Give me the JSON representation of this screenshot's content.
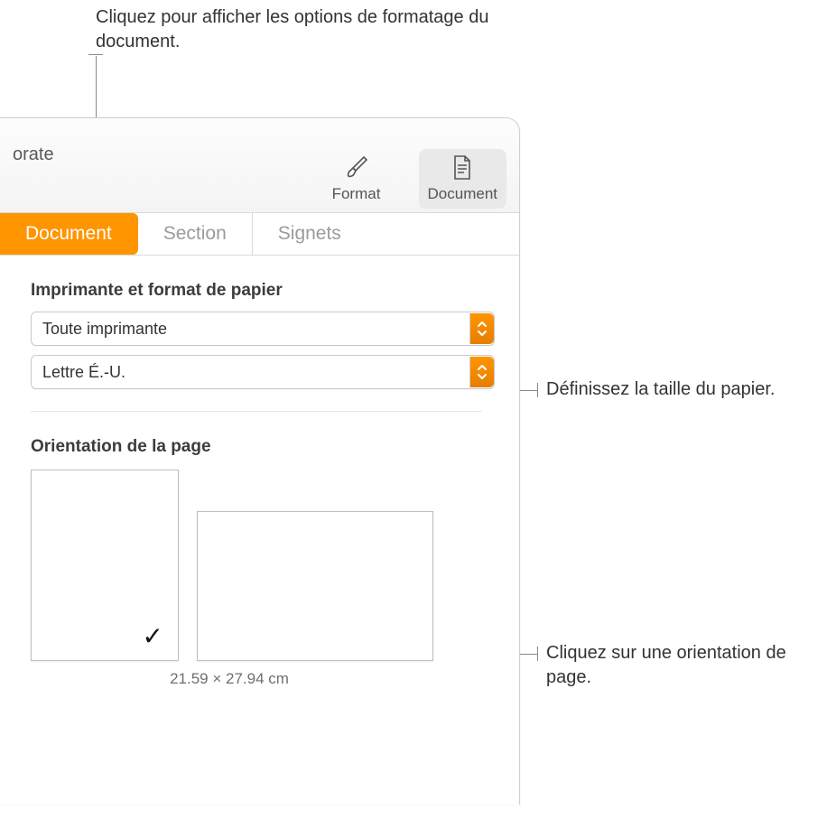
{
  "callouts": {
    "top": "Cliquez pour afficher les options de formatage du document.",
    "right1": "Définissez la taille du papier.",
    "right2": "Cliquez sur une orientation de page."
  },
  "toolbar": {
    "left_fragment": "orate",
    "format_label": "Format",
    "document_label": "Document"
  },
  "tabs": {
    "document": "Document",
    "section": "Section",
    "signets": "Signets"
  },
  "pane": {
    "printer_section_title": "Imprimante et format de papier",
    "printer_value": "Toute imprimante",
    "paper_value": "Lettre É.-U.",
    "orientation_section_title": "Orientation de la page",
    "page_dimensions": "21.59 × 27.94 cm"
  }
}
